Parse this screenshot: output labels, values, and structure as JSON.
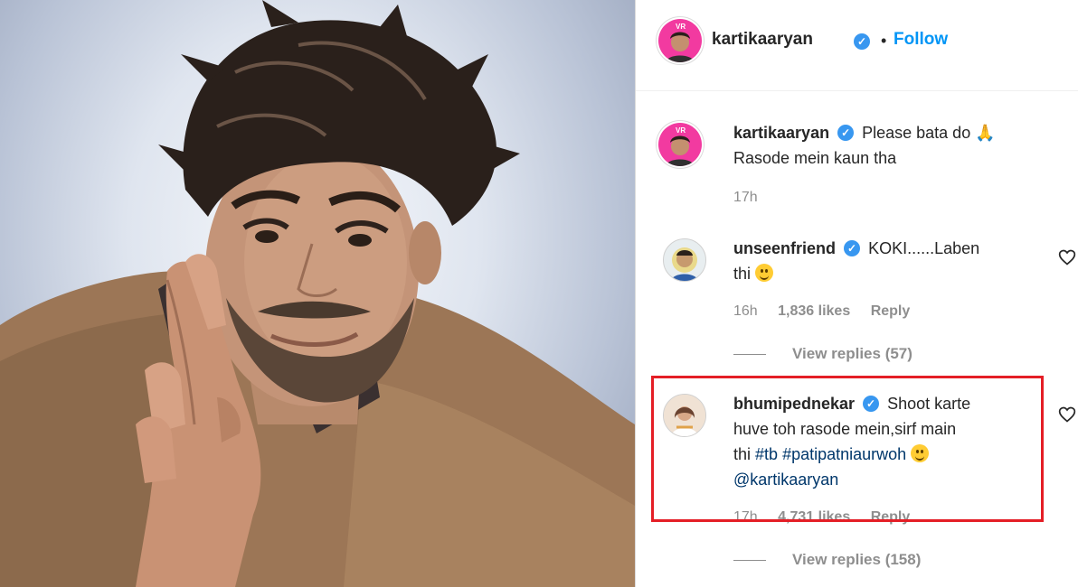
{
  "post": {
    "author": "kartikaaryan",
    "follow_label": "Follow",
    "dot": "•"
  },
  "caption": {
    "username": "kartikaaryan",
    "text": "Please bata do",
    "text_line2": "Rasode mein kaun tha",
    "time": "17h"
  },
  "comments": [
    {
      "username": "unseenfriend",
      "text": "KOKI......Laben",
      "text_line2": "thi",
      "time": "16h",
      "likes": "1,836 likes",
      "reply_label": "Reply",
      "view_replies": "View replies (57)"
    },
    {
      "username": "bhumipednekar",
      "text": "Shoot karte",
      "text_line2": "huve toh rasode mein,sirf main",
      "text_line3_prefix": "thi",
      "tag1": "#tb",
      "tag2": "#patipatniaurwoh",
      "mention": "@kartikaaryan",
      "time": "17h",
      "likes": "4,731 likes",
      "reply_label": "Reply",
      "view_replies": "View replies (158)"
    }
  ],
  "colors": {
    "link": "#0095f6",
    "verified": "#3897f0",
    "highlight": "#e41e26",
    "avatar_bg": "#f23aa0"
  },
  "icons": [
    "verified-badge-icon",
    "heart-icon",
    "pray-emoji-icon",
    "laughing-emoji-icon",
    "smile-emoji-icon"
  ]
}
